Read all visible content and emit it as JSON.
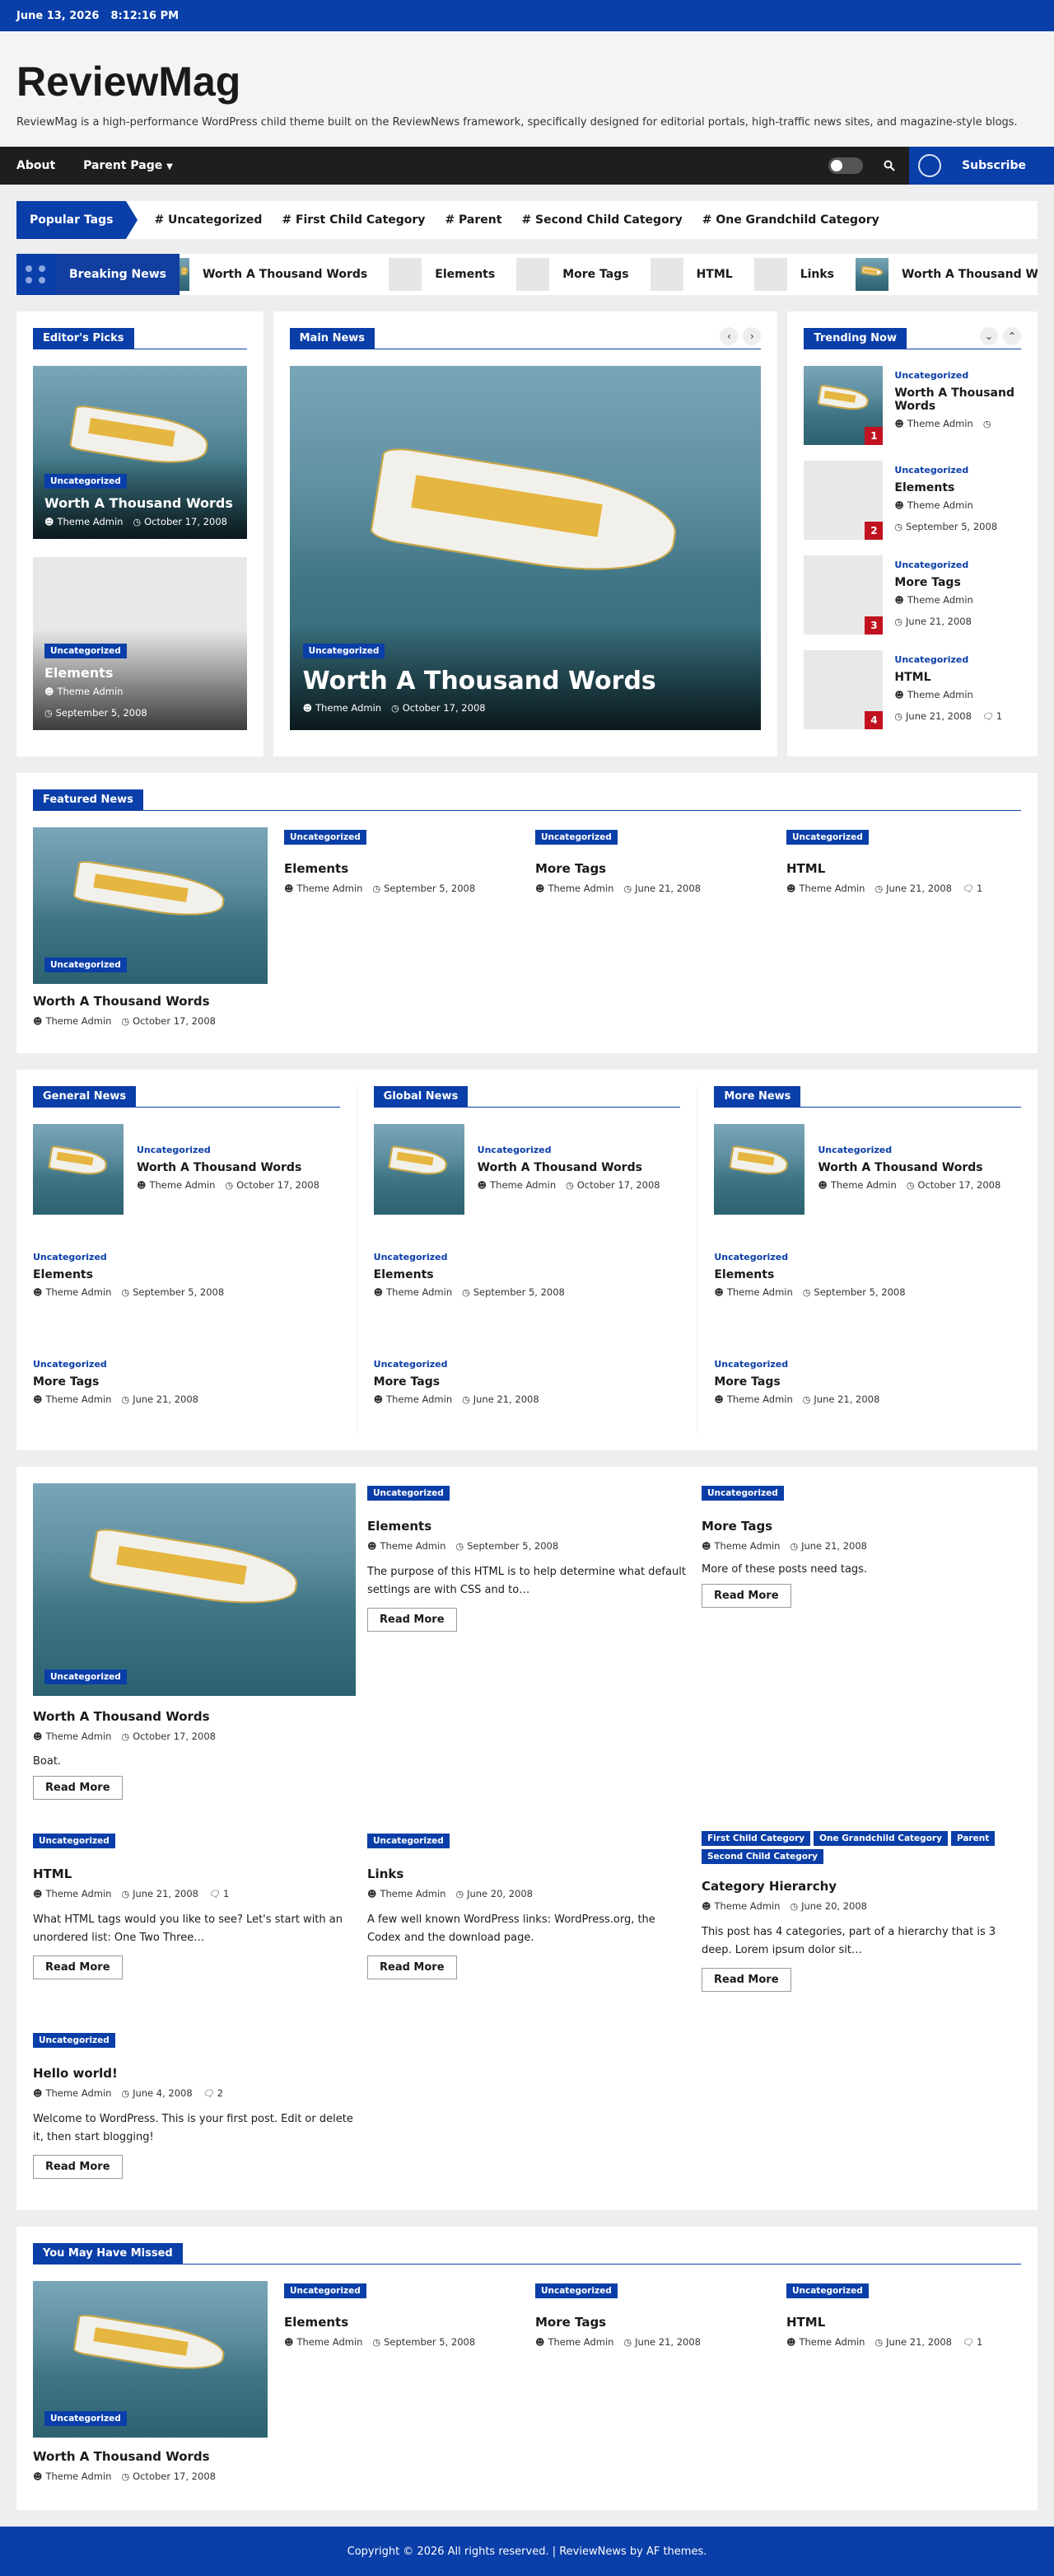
{
  "topbar": {
    "date": "June 13, 2026",
    "time": "8:12:16 PM"
  },
  "site": {
    "title": "ReviewMag",
    "description": "ReviewMag is a high-performance WordPress child theme built on the ReviewNews framework, specifically designed for editorial portals, high-traffic news sites, and magazine-style blogs."
  },
  "nav": {
    "items": [
      "About",
      "Parent Page"
    ],
    "subscribe": "Subscribe"
  },
  "popular_tags": {
    "label": "Popular Tags",
    "tags": [
      "# Uncategorized",
      "# First Child Category",
      "# Parent",
      "# Second Child Category",
      "# One Grandchild Category"
    ]
  },
  "breaking": {
    "label": "Breaking News",
    "items": [
      "Worth A Thousand Words",
      "Elements",
      "More Tags",
      "HTML",
      "Links",
      "Worth A Thousand Words"
    ]
  },
  "common": {
    "author": "Theme Admin",
    "cat": "Uncategorized",
    "read_more": "Read More"
  },
  "editors": {
    "title": "Editor's Picks",
    "posts": [
      {
        "title": "Worth A Thousand Words",
        "date": "October 17, 2008"
      },
      {
        "title": "Elements",
        "date": "September 5, 2008"
      }
    ]
  },
  "main": {
    "title": "Main News",
    "post": {
      "title": "Worth A Thousand Words",
      "date": "October 17, 2008"
    }
  },
  "trending": {
    "title": "Trending Now",
    "posts": [
      {
        "n": "1",
        "title": "Worth A Thousand Words",
        "date": ""
      },
      {
        "n": "2",
        "title": "Elements",
        "date": "September 5, 2008"
      },
      {
        "n": "3",
        "title": "More Tags",
        "date": "June 21, 2008"
      },
      {
        "n": "4",
        "title": "HTML",
        "date": "June 21, 2008",
        "comments": "1"
      }
    ]
  },
  "featured": {
    "title": "Featured News",
    "big": {
      "title": "Worth A Thousand Words",
      "date": "October 17, 2008"
    },
    "posts": [
      {
        "title": "Elements",
        "date": "September 5, 2008"
      },
      {
        "title": "More Tags",
        "date": "June 21, 2008"
      },
      {
        "title": "HTML",
        "date": "June 21, 2008",
        "comments": "1"
      }
    ]
  },
  "columns": [
    {
      "title": "General News",
      "posts": [
        {
          "title": "Worth A Thousand Words",
          "date": "October 17, 2008"
        },
        {
          "title": "Elements",
          "date": "September 5, 2008"
        },
        {
          "title": "More Tags",
          "date": "June 21, 2008"
        }
      ]
    },
    {
      "title": "Global News",
      "posts": [
        {
          "title": "Worth A Thousand Words",
          "date": "October 17, 2008"
        },
        {
          "title": "Elements",
          "date": "September 5, 2008"
        },
        {
          "title": "More Tags",
          "date": "June 21, 2008"
        }
      ]
    },
    {
      "title": "More News",
      "posts": [
        {
          "title": "Worth A Thousand Words",
          "date": "October 17, 2008"
        },
        {
          "title": "Elements",
          "date": "September 5, 2008"
        },
        {
          "title": "More Tags",
          "date": "June 21, 2008"
        }
      ]
    }
  ],
  "grid": {
    "big": {
      "title": "Worth A Thousand Words",
      "date": "October 17, 2008",
      "excerpt": "Boat."
    },
    "elements": {
      "title": "Elements",
      "date": "September 5, 2008",
      "excerpt": "The purpose of this HTML is to help determine what default settings are with CSS and to…"
    },
    "moretags": {
      "title": "More Tags",
      "date": "June 21, 2008",
      "excerpt": "More of these posts need tags."
    },
    "html": {
      "title": "HTML",
      "date": "June 21, 2008",
      "comments": "1",
      "excerpt": "What HTML tags would you like to see? Let's start with an unordered list: One Two Three…"
    },
    "links": {
      "title": "Links",
      "date": "June 20, 2008",
      "excerpt": "A few well known WordPress links: WordPress.org, the Codex and the download page."
    },
    "hierarchy": {
      "cats": [
        "First Child Category",
        "One Grandchild Category",
        "Parent",
        "Second Child Category"
      ],
      "title": "Category Hierarchy",
      "date": "June 20, 2008",
      "excerpt": "This post has 4 categories, part of a hierarchy that is 3 deep. Lorem ipsum dolor sit…"
    },
    "hello": {
      "title": "Hello world!",
      "date": "June 4, 2008",
      "comments": "2",
      "excerpt": "Welcome to WordPress. This is your first post. Edit or delete it, then start blogging!"
    }
  },
  "missed": {
    "title": "You May Have Missed",
    "big": {
      "title": "Worth A Thousand Words",
      "date": "October 17, 2008"
    },
    "posts": [
      {
        "title": "Elements",
        "date": "September 5, 2008"
      },
      {
        "title": "More Tags",
        "date": "June 21, 2008"
      },
      {
        "title": "HTML",
        "date": "June 21, 2008",
        "comments": "1"
      }
    ]
  },
  "footer": {
    "text": "Copyright © 2026 All rights reserved.  |  ReviewNews by AF themes."
  }
}
